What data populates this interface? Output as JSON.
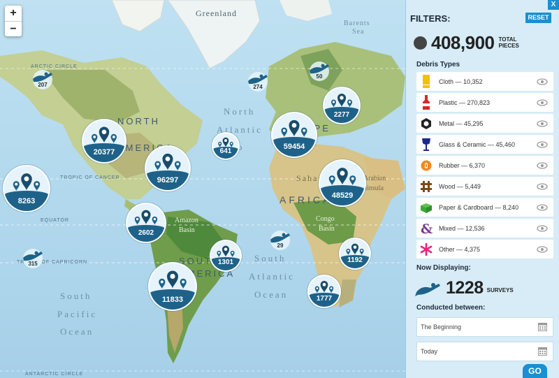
{
  "map": {
    "zoom_in": "+",
    "zoom_out": "−",
    "labels": {
      "greenland": "Greenland",
      "barents_sea": [
        "Barents",
        "Sea"
      ],
      "arctic_circle": "ARCTIC CIRCLE",
      "north_atlantic": [
        "North",
        "Atlantic"
      ],
      "tropic_cancer": "TROPIC OF CANCER",
      "equator": "EQUATOR",
      "tropic_capricorn": "TROPIC OF CAPRICORN",
      "antarctic_circle": "ANTARCTIC CIRCLE",
      "north_america": [
        "NORTH",
        "AMERICA"
      ],
      "europe": "EUROPE",
      "africa": "AFRICA",
      "south_america": [
        "SOUTH",
        "AMERICA"
      ],
      "sahara": "Sahara",
      "arabian_peninsula": [
        "Arabian",
        "Peninsula"
      ],
      "amazon_basin": [
        "Amazon",
        "Basin"
      ],
      "congo_basin": [
        "Congo",
        "Basin"
      ],
      "south_atlantic": [
        "South",
        "Atlantic",
        "Ocean"
      ],
      "south_pacific": [
        "South",
        "Pacific",
        "Ocean"
      ],
      "ocean_fragment": "o"
    },
    "clusters": [
      {
        "id": "north-america",
        "count": "20377"
      },
      {
        "id": "us-south",
        "count": "96297"
      },
      {
        "id": "hawaii",
        "count": "8263"
      },
      {
        "id": "europe",
        "count": "59454"
      },
      {
        "id": "scandinavia",
        "count": "2277"
      },
      {
        "id": "azores",
        "count": "641"
      },
      {
        "id": "africa",
        "count": "48529"
      },
      {
        "id": "central-america",
        "count": "2602"
      },
      {
        "id": "brazil-east",
        "count": "1301"
      },
      {
        "id": "south-america",
        "count": "11833"
      },
      {
        "id": "st-helena",
        "count": "1192"
      },
      {
        "id": "south-africa",
        "count": "1777"
      }
    ],
    "divers": [
      {
        "id": "alaska",
        "count": "207"
      },
      {
        "id": "greenland-east",
        "count": "274"
      },
      {
        "id": "norway-north",
        "count": "50"
      },
      {
        "id": "atlantic-south",
        "count": "29"
      },
      {
        "id": "tahiti",
        "count": "315"
      }
    ]
  },
  "panel": {
    "close": "X",
    "title": "FILTERS:",
    "reset": "RESET",
    "total_value": "408,900",
    "total_label": [
      "TOTAL",
      "PIECES"
    ],
    "debris_heading": "Debris Types",
    "debris": [
      {
        "label": "Cloth — 10,352",
        "icon": "cloth-icon",
        "color": "#f2c200"
      },
      {
        "label": "Plastic — 270,823",
        "icon": "plastic-bottle-icon",
        "color": "#d9262b"
      },
      {
        "label": "Metal — 45,295",
        "icon": "metal-nut-icon",
        "color": "#222222"
      },
      {
        "label": "Glass & Ceramic — 45,460",
        "icon": "glass-icon",
        "color": "#1b2a8c"
      },
      {
        "label": "Rubber — 6,370",
        "icon": "rubber-icon",
        "color": "#f08a1d"
      },
      {
        "label": "Wood — 5,449",
        "icon": "wood-icon",
        "color": "#7a4a1e"
      },
      {
        "label": "Paper & Cardboard — 8,240",
        "icon": "paper-box-icon",
        "color": "#3aaa35"
      },
      {
        "label": "Mixed — 12,536",
        "icon": "mixed-icon",
        "color": "#7a3a8c"
      },
      {
        "label": "Other — 4,375",
        "icon": "other-asterisk-icon",
        "color": "#e6227e"
      }
    ],
    "now_displaying": "Now Displaying:",
    "survey_count": "1228",
    "survey_label": "SURVEYS",
    "conducted_between": "Conducted between:",
    "date_from": "The Beginning",
    "date_to": "Today",
    "go": "GO"
  }
}
